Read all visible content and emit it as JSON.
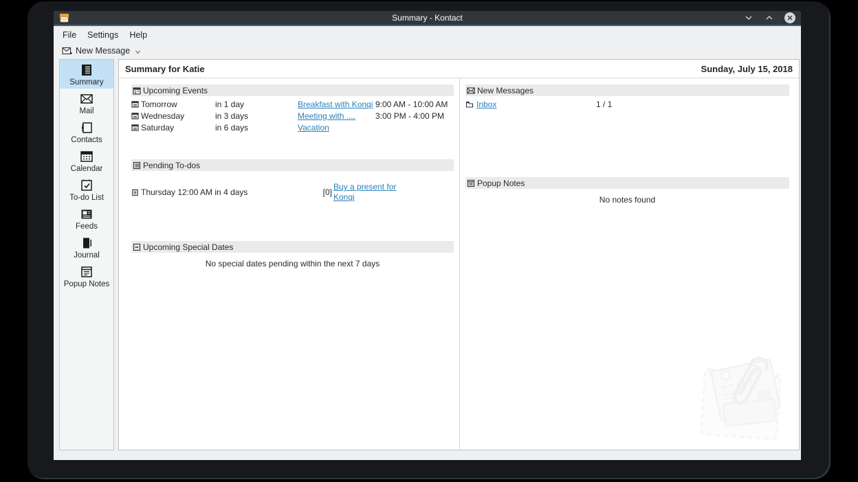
{
  "window": {
    "title": "Summary - Kontact"
  },
  "menu": {
    "items": [
      "File",
      "Settings",
      "Help"
    ]
  },
  "toolbar": {
    "new_message": "New Message"
  },
  "sidebar": {
    "items": [
      {
        "label": "Summary",
        "selected": true
      },
      {
        "label": "Mail",
        "selected": false
      },
      {
        "label": "Contacts",
        "selected": false
      },
      {
        "label": "Calendar",
        "selected": false
      },
      {
        "label": "To-do List",
        "selected": false
      },
      {
        "label": "Feeds",
        "selected": false
      },
      {
        "label": "Journal",
        "selected": false
      },
      {
        "label": "Popup Notes",
        "selected": false
      }
    ]
  },
  "main": {
    "header": {
      "title": "Summary for Katie",
      "date": "Sunday, July 15, 2018"
    },
    "upcoming_events": {
      "title": "Upcoming Events",
      "rows": [
        {
          "day": "Tomorrow",
          "relative": "in 1 day",
          "link": "Breakfast with Konqi",
          "time": "9:00 AM - 10:00 AM"
        },
        {
          "day": "Wednesday",
          "relative": "in 3 days",
          "link": "Meeting with ....",
          "time": "3:00 PM - 4:00 PM"
        },
        {
          "day": "Saturday",
          "relative": "in 6 days",
          "link": "Vacation",
          "time": ""
        }
      ]
    },
    "pending_todos": {
      "title": "Pending To-dos",
      "rows": [
        {
          "when": "Thursday 12:00 AM in 4 days",
          "badge": "[0]",
          "link": "Buy a present for Konqi"
        }
      ]
    },
    "special_dates": {
      "title": "Upcoming Special Dates",
      "empty": "No special dates pending within the next 7 days"
    },
    "new_messages": {
      "title": "New Messages",
      "rows": [
        {
          "folder": "Inbox",
          "count": "1 / 1"
        }
      ]
    },
    "popup_notes": {
      "title": "Popup Notes",
      "empty": "No notes found"
    }
  },
  "colors": {
    "titlebar": "#31363b",
    "titlebar_accent": "#35678a",
    "window_bg": "#eff0f1",
    "selection": "#c3e0f6",
    "link": "#2980b9",
    "section_header_bg": "#e9eaeb"
  }
}
